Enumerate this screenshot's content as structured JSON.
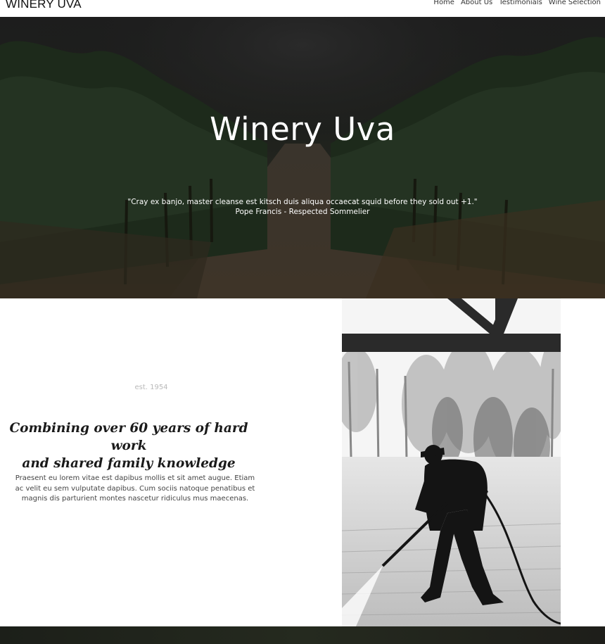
{
  "nav": {
    "brand": "WINERY UVA",
    "links": [
      "Home",
      "About Us",
      "Testimonials",
      "Wine Selection"
    ]
  },
  "hero": {
    "title": "Winery Uva",
    "quote": "\"Cray ex banjo, master cleanse est kitsch duis aliqua occaecat squid before they sold out +1.\"",
    "attribution": "Pope Francis - Respected Sommelier"
  },
  "about": {
    "est": "est. 1954",
    "headline_line1": "Combining over 60 years of hard work",
    "headline_line2": "and shared family knowledge",
    "paragraph_line1": "Praesent eu lorem vitae est dapibus mollis et sit amet augue. Etiam",
    "paragraph_line2": "ac velit eu sem vulputate dapibus. Cum sociis natoque penatibus et",
    "paragraph_line3": "magnis dis parturient montes nascetur ridiculus mus maecenas."
  },
  "colors": {
    "hero_bg": "#1e211c",
    "text_light": "#ffffff",
    "text_dark": "#1a1a1a"
  }
}
